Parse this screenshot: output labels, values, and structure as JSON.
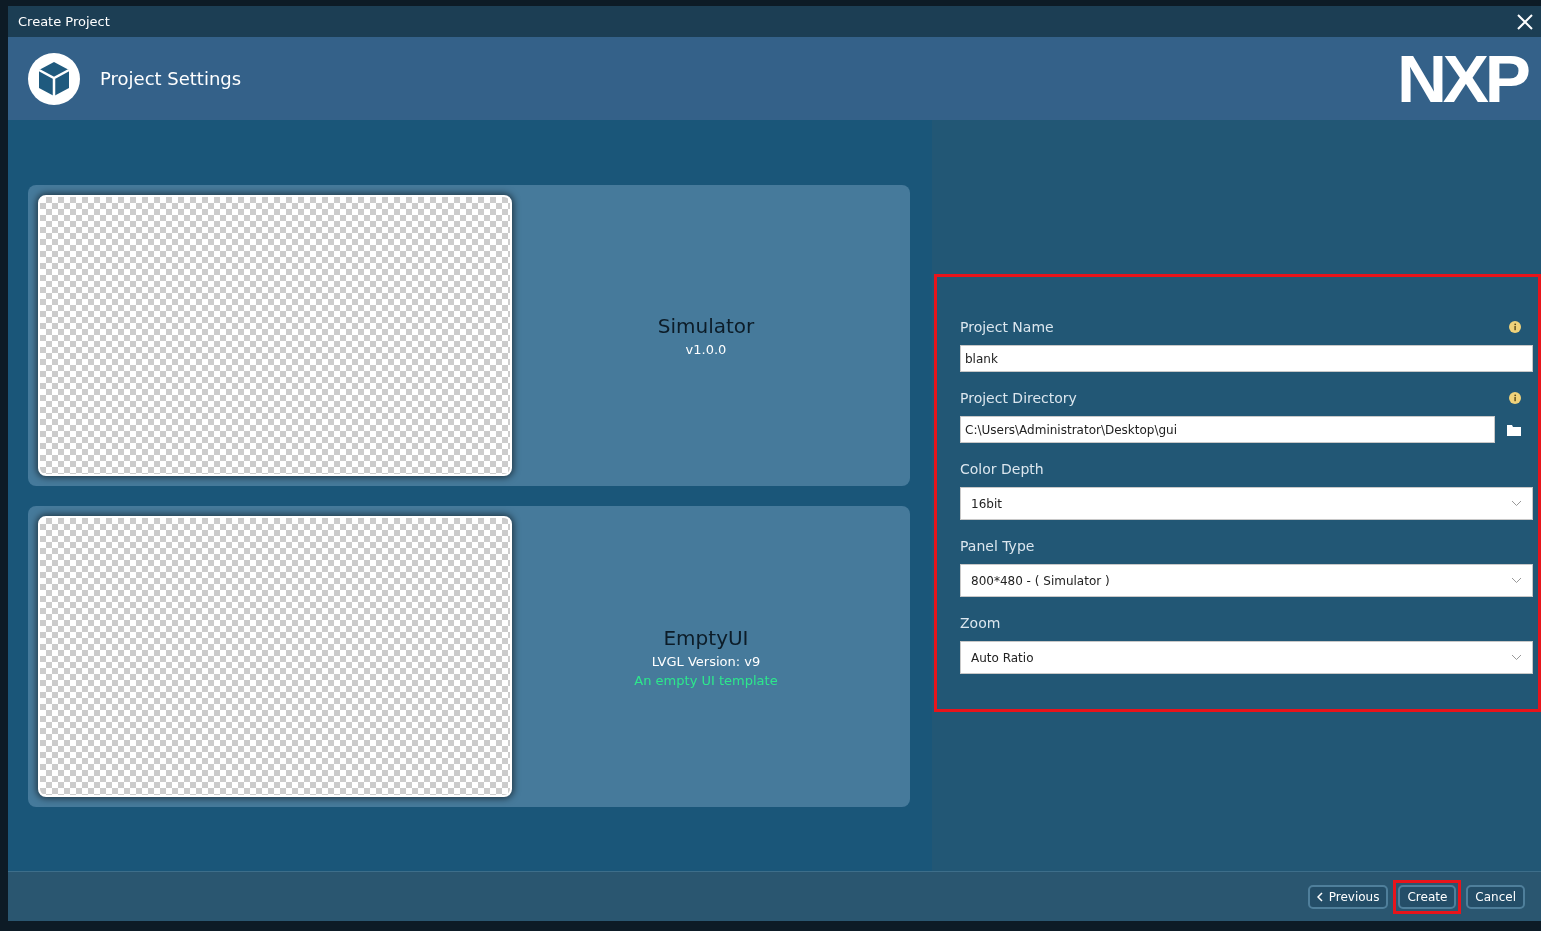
{
  "window": {
    "title": "Create Project"
  },
  "header": {
    "title": "Project Settings",
    "logo": "NXP"
  },
  "templates": [
    {
      "name": "Simulator",
      "version": "v1.0.0"
    },
    {
      "name": "EmptyUI",
      "version": "LVGL Version: v9",
      "description": "An empty UI template"
    }
  ],
  "form": {
    "highlighted": true,
    "fields": [
      {
        "kind": "text",
        "label": "Project Name",
        "value": "blank",
        "info": true
      },
      {
        "kind": "path",
        "label": "Project Directory",
        "value": "C:\\Users\\Administrator\\Desktop\\gui",
        "info": true
      },
      {
        "kind": "select",
        "label": "Color Depth",
        "value": "16bit",
        "info": false
      },
      {
        "kind": "select",
        "label": "Panel Type",
        "value": "800*480 - ( Simulator )",
        "info": false
      },
      {
        "kind": "select",
        "label": "Zoom",
        "value": "Auto Ratio",
        "info": false
      }
    ]
  },
  "buttons": [
    {
      "kind": "back",
      "label": "Previous",
      "highlighted": false
    },
    {
      "kind": "plain",
      "label": "Create",
      "highlighted": true
    },
    {
      "kind": "plain",
      "label": "Cancel",
      "highlighted": false
    }
  ]
}
